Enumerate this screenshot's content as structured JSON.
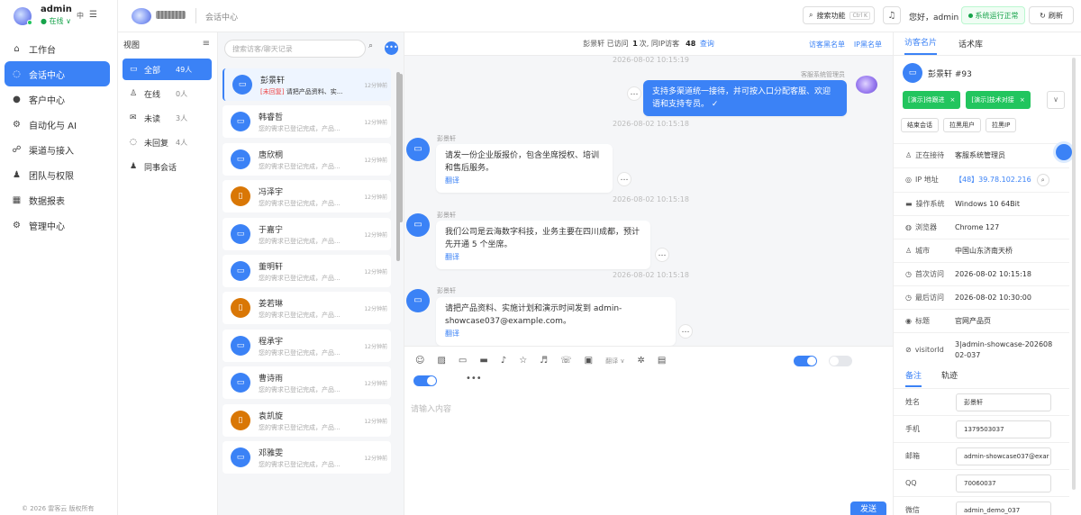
{
  "nav": {
    "user": "admin",
    "status": "● 在线 ∨",
    "lang": "中",
    "items": [
      {
        "icon": "home-icon",
        "glyph": "⌂",
        "label": "工作台"
      },
      {
        "icon": "chat-icon",
        "glyph": "◌",
        "label": "会话中心"
      },
      {
        "icon": "user-icon",
        "glyph": "●",
        "label": "客户中心"
      },
      {
        "icon": "automation-icon",
        "glyph": "⚙",
        "label": "自动化与 AI"
      },
      {
        "icon": "channel-icon",
        "glyph": "☍",
        "label": "渠道与接入"
      },
      {
        "icon": "team-icon",
        "glyph": "♟",
        "label": "团队与权限"
      },
      {
        "icon": "report-icon",
        "glyph": "▦",
        "label": "数据报表"
      },
      {
        "icon": "settings-icon",
        "glyph": "⚙",
        "label": "管理中心"
      }
    ],
    "copyright": "© 2026 雷客云 版权所有"
  },
  "topbar": {
    "title": "会话中心",
    "search_label": "搜索功能",
    "search_kbd": "Ctrl K",
    "hello": "您好，admin",
    "status": "系统运行正常",
    "refresh": "刷新"
  },
  "views": {
    "title": "视图",
    "items": [
      {
        "icon": "folder-icon",
        "glyph": "▭",
        "label": "全部",
        "count": "49人"
      },
      {
        "icon": "online-icon",
        "glyph": "♙",
        "label": "在线",
        "count": "0人"
      },
      {
        "icon": "unread-icon",
        "glyph": "✉",
        "label": "未读",
        "count": "3人"
      },
      {
        "icon": "unreplied-icon",
        "glyph": "◌",
        "label": "未回复",
        "count": "4人"
      },
      {
        "icon": "colleague-icon",
        "glyph": "♟",
        "label": "同事会话",
        "count": ""
      }
    ]
  },
  "vlist": {
    "search_placeholder": "搜索访客/聊天记录",
    "cards": [
      {
        "name": "彭景轩",
        "tag": "[未回复]",
        "text": "请把产品资料、实...",
        "time": "12分钟前",
        "avatar": "desktop"
      },
      {
        "name": "韩睿哲",
        "tag": "",
        "text": "您的需求已登记完成，产品...",
        "time": "12分钟前",
        "avatar": "desktop"
      },
      {
        "name": "唐欣桐",
        "tag": "",
        "text": "您的需求已登记完成，产品...",
        "time": "12分钟前",
        "avatar": "desktop"
      },
      {
        "name": "冯泽宇",
        "tag": "",
        "text": "您的需求已登记完成，产品...",
        "time": "12分钟前",
        "avatar": "mobile"
      },
      {
        "name": "于嘉宁",
        "tag": "",
        "text": "您的需求已登记完成，产品...",
        "time": "12分钟前",
        "avatar": "desktop"
      },
      {
        "name": "董明轩",
        "tag": "",
        "text": "您的需求已登记完成，产品...",
        "time": "12分钟前",
        "avatar": "desktop"
      },
      {
        "name": "姜若琳",
        "tag": "",
        "text": "您的需求已登记完成，产品...",
        "time": "12分钟前",
        "avatar": "mobile"
      },
      {
        "name": "程承宇",
        "tag": "",
        "text": "您的需求已登记完成，产品...",
        "time": "12分钟前",
        "avatar": "desktop"
      },
      {
        "name": "曹诗雨",
        "tag": "",
        "text": "您的需求已登记完成，产品...",
        "time": "12分钟前",
        "avatar": "desktop"
      },
      {
        "name": "袁凯旋",
        "tag": "",
        "text": "您的需求已登记完成，产品...",
        "time": "12分钟前",
        "avatar": "mobile"
      },
      {
        "name": "邓雅雯",
        "tag": "",
        "text": "您的需求已登记完成，产品...",
        "time": "12分钟前",
        "avatar": "desktop"
      }
    ]
  },
  "chat": {
    "header_name": "彭景轩",
    "header_visited": "已访问",
    "header_visits": "1",
    "header_visits_unit": "次,",
    "header_same_ip": "同IP访客",
    "header_same_ip_count": "48",
    "header_view": "查询",
    "blacklist": "访客黑名单",
    "ip_blacklist": "IP黑名单",
    "ts1": "2026-08-02 10:15:19",
    "agent_name": "客服系统管理员",
    "agent_msg": "支持多渠道统一接待，并可按入口分配客服、欢迎语和支持专员。 ✓",
    "ts2": "2026-08-02 10:15:18",
    "visitor_name": "彭景轩",
    "msg1": "请发一份企业版报价，包含坐席授权、培训和售后服务。",
    "ts3": "2026-08-02 10:15:18",
    "msg2": "我们公司是云海数字科技，业务主要在四川成都，预计先开通 5 个坐席。",
    "ts4": "2026-08-02 10:15:18",
    "msg3": "请把产品资料、实施计划和演示时间发到 admin-showcase037@example.com。",
    "translate": "翻译",
    "more": "…"
  },
  "composer": {
    "translate_label": "翻译",
    "placeholder": "请输入内容",
    "send": "发送"
  },
  "rpanel": {
    "tab_card": "访客名片",
    "tab_lib": "话术库",
    "name": "彭景轩 #93",
    "tag1": "[演示]待跟进",
    "tag2": "[演示]技术对接",
    "btn_end": "结束会话",
    "btn_block": "拉黑用户",
    "btn_blockip": "拉黑IP",
    "info": [
      {
        "label": "正在接待",
        "icon": "agent-icon",
        "glyph": "♙",
        "value": "客服系统管理员"
      },
      {
        "label": "IP 地址",
        "icon": "ip-icon",
        "glyph": "◎",
        "value": "【48】39.78.102.216"
      },
      {
        "label": "操作系统",
        "icon": "os-icon",
        "glyph": "▬",
        "value": "Windows 10 64Bit"
      },
      {
        "label": "浏览器",
        "icon": "browser-icon",
        "glyph": "◍",
        "value": "Chrome 127"
      },
      {
        "label": "城市",
        "icon": "city-icon",
        "glyph": "♙",
        "value": "中国山东济南天桥"
      },
      {
        "label": "首次访问",
        "icon": "clock-icon",
        "glyph": "◷",
        "value": "2026-08-02 10:15:18"
      },
      {
        "label": "最后访问",
        "icon": "clock-icon",
        "glyph": "◷",
        "value": "2026-08-02 10:30:00"
      },
      {
        "label": "标题",
        "icon": "title-icon",
        "glyph": "◉",
        "value": "官网产品页"
      },
      {
        "label": "visitorId",
        "icon": "id-icon",
        "glyph": "⊘",
        "value": "3|admin-showcase-20260802-037"
      }
    ],
    "sub_note": "备注",
    "sub_track": "轨迹",
    "fields": [
      {
        "label": "姓名",
        "value": "彭景轩"
      },
      {
        "label": "手机",
        "value": "1379503037"
      },
      {
        "label": "邮箱",
        "value": "admin-showcase037@exar"
      },
      {
        "label": "QQ",
        "value": "70060037"
      },
      {
        "label": "微信",
        "value": "admin_demo_037"
      }
    ]
  },
  "colors": {
    "accent": "#3b82f6",
    "success": "#22c55e",
    "danger": "#ef4444"
  }
}
